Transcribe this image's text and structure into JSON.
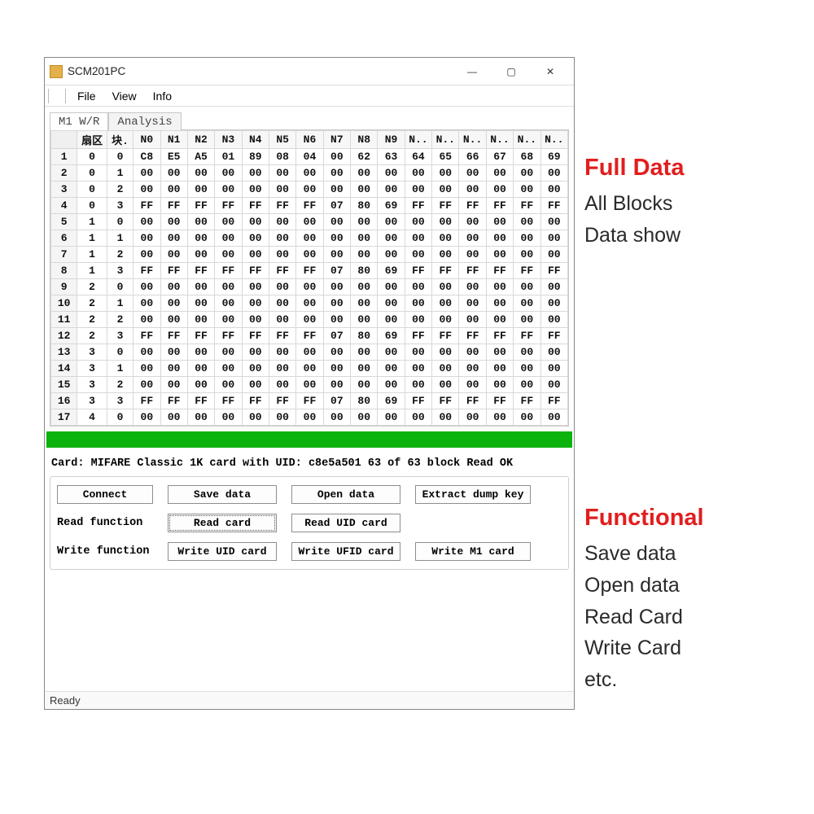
{
  "window": {
    "title": "SCM201PC",
    "controls": {
      "min": "—",
      "max": "▢",
      "close": "✕"
    }
  },
  "menu": {
    "file": "File",
    "view": "View",
    "info": "Info"
  },
  "tabs": {
    "m1wr": "M1 W/R",
    "analysis": "Analysis"
  },
  "grid": {
    "headers": {
      "corner": "",
      "sector": "扇区",
      "block": "块.",
      "bytes": [
        "N0",
        "N1",
        "N2",
        "N3",
        "N4",
        "N5",
        "N6",
        "N7",
        "N8",
        "N9",
        "N..",
        "N..",
        "N..",
        "N..",
        "N..",
        "N.."
      ]
    },
    "rows": [
      {
        "n": "1",
        "sec": "0",
        "blk": "0",
        "b": [
          "C8",
          "E5",
          "A5",
          "01",
          "89",
          "08",
          "04",
          "00",
          "62",
          "63",
          "64",
          "65",
          "66",
          "67",
          "68",
          "69"
        ]
      },
      {
        "n": "2",
        "sec": "0",
        "blk": "1",
        "b": [
          "00",
          "00",
          "00",
          "00",
          "00",
          "00",
          "00",
          "00",
          "00",
          "00",
          "00",
          "00",
          "00",
          "00",
          "00",
          "00"
        ]
      },
      {
        "n": "3",
        "sec": "0",
        "blk": "2",
        "b": [
          "00",
          "00",
          "00",
          "00",
          "00",
          "00",
          "00",
          "00",
          "00",
          "00",
          "00",
          "00",
          "00",
          "00",
          "00",
          "00"
        ]
      },
      {
        "n": "4",
        "sec": "0",
        "blk": "3",
        "b": [
          "FF",
          "FF",
          "FF",
          "FF",
          "FF",
          "FF",
          "FF",
          "07",
          "80",
          "69",
          "FF",
          "FF",
          "FF",
          "FF",
          "FF",
          "FF"
        ]
      },
      {
        "n": "5",
        "sec": "1",
        "blk": "0",
        "b": [
          "00",
          "00",
          "00",
          "00",
          "00",
          "00",
          "00",
          "00",
          "00",
          "00",
          "00",
          "00",
          "00",
          "00",
          "00",
          "00"
        ]
      },
      {
        "n": "6",
        "sec": "1",
        "blk": "1",
        "b": [
          "00",
          "00",
          "00",
          "00",
          "00",
          "00",
          "00",
          "00",
          "00",
          "00",
          "00",
          "00",
          "00",
          "00",
          "00",
          "00"
        ]
      },
      {
        "n": "7",
        "sec": "1",
        "blk": "2",
        "b": [
          "00",
          "00",
          "00",
          "00",
          "00",
          "00",
          "00",
          "00",
          "00",
          "00",
          "00",
          "00",
          "00",
          "00",
          "00",
          "00"
        ]
      },
      {
        "n": "8",
        "sec": "1",
        "blk": "3",
        "b": [
          "FF",
          "FF",
          "FF",
          "FF",
          "FF",
          "FF",
          "FF",
          "07",
          "80",
          "69",
          "FF",
          "FF",
          "FF",
          "FF",
          "FF",
          "FF"
        ]
      },
      {
        "n": "9",
        "sec": "2",
        "blk": "0",
        "b": [
          "00",
          "00",
          "00",
          "00",
          "00",
          "00",
          "00",
          "00",
          "00",
          "00",
          "00",
          "00",
          "00",
          "00",
          "00",
          "00"
        ]
      },
      {
        "n": "10",
        "sec": "2",
        "blk": "1",
        "b": [
          "00",
          "00",
          "00",
          "00",
          "00",
          "00",
          "00",
          "00",
          "00",
          "00",
          "00",
          "00",
          "00",
          "00",
          "00",
          "00"
        ]
      },
      {
        "n": "11",
        "sec": "2",
        "blk": "2",
        "b": [
          "00",
          "00",
          "00",
          "00",
          "00",
          "00",
          "00",
          "00",
          "00",
          "00",
          "00",
          "00",
          "00",
          "00",
          "00",
          "00"
        ]
      },
      {
        "n": "12",
        "sec": "2",
        "blk": "3",
        "b": [
          "FF",
          "FF",
          "FF",
          "FF",
          "FF",
          "FF",
          "FF",
          "07",
          "80",
          "69",
          "FF",
          "FF",
          "FF",
          "FF",
          "FF",
          "FF"
        ]
      },
      {
        "n": "13",
        "sec": "3",
        "blk": "0",
        "b": [
          "00",
          "00",
          "00",
          "00",
          "00",
          "00",
          "00",
          "00",
          "00",
          "00",
          "00",
          "00",
          "00",
          "00",
          "00",
          "00"
        ]
      },
      {
        "n": "14",
        "sec": "3",
        "blk": "1",
        "b": [
          "00",
          "00",
          "00",
          "00",
          "00",
          "00",
          "00",
          "00",
          "00",
          "00",
          "00",
          "00",
          "00",
          "00",
          "00",
          "00"
        ]
      },
      {
        "n": "15",
        "sec": "3",
        "blk": "2",
        "b": [
          "00",
          "00",
          "00",
          "00",
          "00",
          "00",
          "00",
          "00",
          "00",
          "00",
          "00",
          "00",
          "00",
          "00",
          "00",
          "00"
        ]
      },
      {
        "n": "16",
        "sec": "3",
        "blk": "3",
        "b": [
          "FF",
          "FF",
          "FF",
          "FF",
          "FF",
          "FF",
          "FF",
          "07",
          "80",
          "69",
          "FF",
          "FF",
          "FF",
          "FF",
          "FF",
          "FF"
        ]
      },
      {
        "n": "17",
        "sec": "4",
        "blk": "0",
        "b": [
          "00",
          "00",
          "00",
          "00",
          "00",
          "00",
          "00",
          "00",
          "00",
          "00",
          "00",
          "00",
          "00",
          "00",
          "00",
          "00"
        ]
      }
    ]
  },
  "card_status": "Card: MIFARE Classic 1K card with UID: c8e5a501 63 of 63 block Read OK",
  "labels": {
    "read_fn": "Read function",
    "write_fn": "Write function"
  },
  "buttons": {
    "connect": "Connect",
    "save": "Save data",
    "open": "Open data",
    "extract": "Extract dump key",
    "read_card": "Read card",
    "read_uid": "Read UID card",
    "write_uid": "Write UID card",
    "write_ufid": "Write UFID card",
    "write_m1": "Write M1 card"
  },
  "statusbar": "Ready",
  "annotations": {
    "full_data": {
      "title": "Full Data",
      "line1": "All Blocks",
      "line2": "Data show"
    },
    "functional": {
      "title": "Functional",
      "l1": "Save data",
      "l2": "Open data",
      "l3": "Read Card",
      "l4": "Write Card",
      "l5": "etc."
    }
  }
}
